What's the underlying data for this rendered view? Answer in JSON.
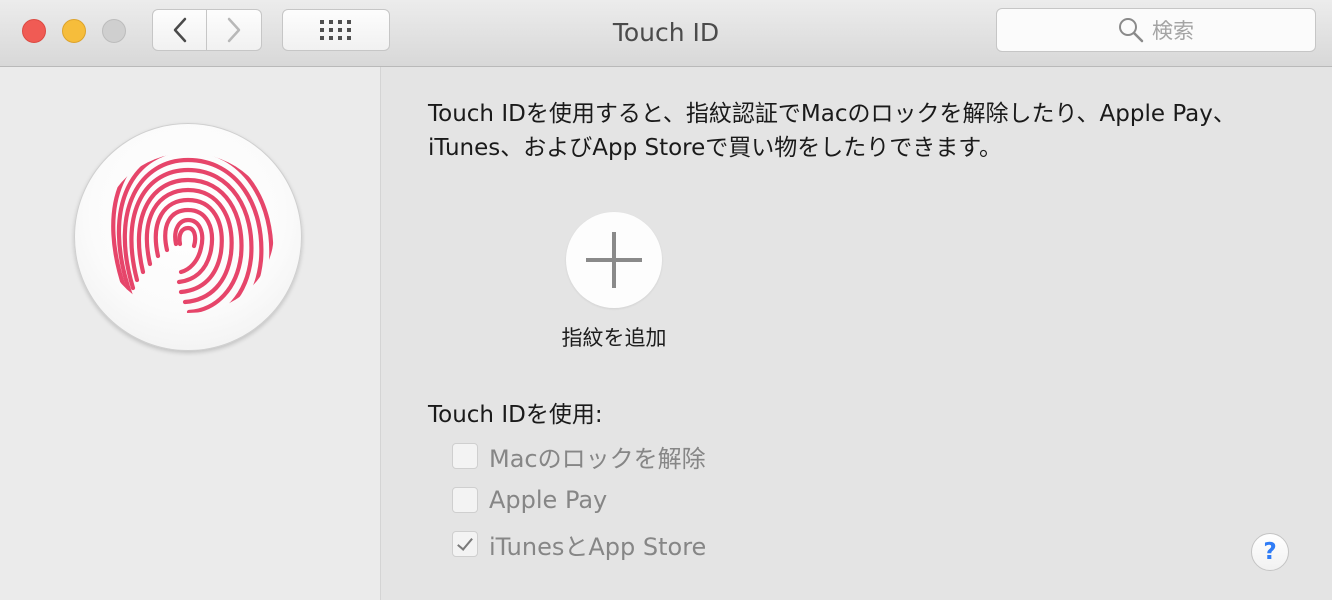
{
  "window": {
    "title": "Touch ID",
    "search_placeholder": "検索"
  },
  "toolbar": {
    "back_icon": "chevron-left-icon",
    "forward_icon": "chevron-right-icon",
    "grid_icon": "grid-icon"
  },
  "main": {
    "description_line1": "Touch IDを使用すると、指紋認証でMacのロックを解除したり、Apple Pay、",
    "description_line2": "iTunes、およびApp Storeで買い物をしたりできます。",
    "add_fingerprint_label": "指紋を追加",
    "use_heading": "Touch IDを使用:",
    "options": [
      {
        "label": "Macのロックを解除",
        "checked": false
      },
      {
        "label": "Apple Pay",
        "checked": false
      },
      {
        "label": "iTunesとApp Store",
        "checked": true
      }
    ],
    "help_label": "?"
  },
  "colors": {
    "fingerprint": "#e6456a",
    "close": "#f05b54",
    "minimize": "#f6bd3b",
    "help": "#2f7cf6"
  }
}
